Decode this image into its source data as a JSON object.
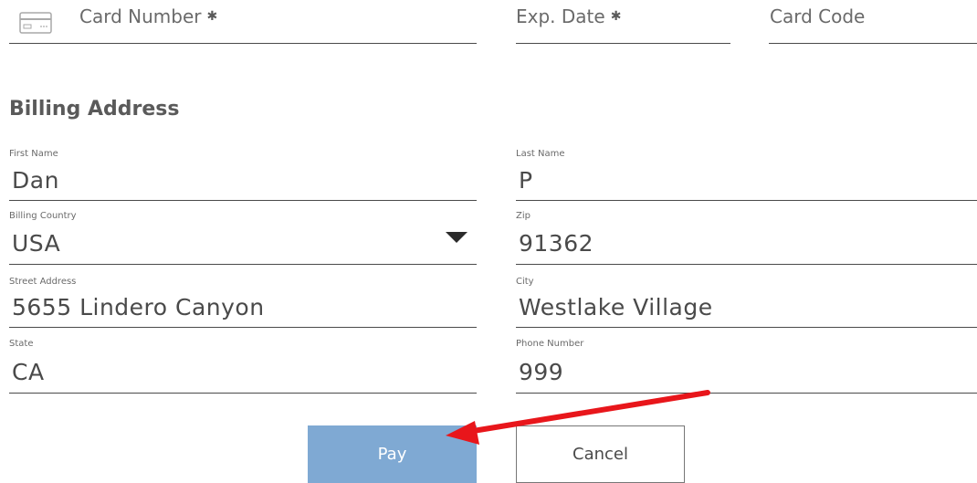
{
  "payment": {
    "card_number_label": "Card Number",
    "exp_date_label": "Exp. Date",
    "card_code_label": "Card Code",
    "required_mark": "✱"
  },
  "billing": {
    "heading": "Billing Address",
    "first_name": {
      "label": "First Name",
      "value": "Dan"
    },
    "last_name": {
      "label": "Last Name",
      "value": "P"
    },
    "country": {
      "label": "Billing Country",
      "value": "USA"
    },
    "zip": {
      "label": "Zip",
      "value": "91362"
    },
    "street": {
      "label": "Street Address",
      "value": "5655 Lindero Canyon"
    },
    "city": {
      "label": "City",
      "value": "Westlake Village"
    },
    "state": {
      "label": "State",
      "value": "CA"
    },
    "phone": {
      "label": "Phone Number",
      "value": "999"
    }
  },
  "actions": {
    "pay_label": "Pay",
    "cancel_label": "Cancel"
  },
  "colors": {
    "pay_button": "#7fa9d3",
    "annotation_arrow": "#e8161b"
  },
  "icons": {
    "card": "credit-card-icon",
    "dropdown": "caret-down-icon"
  }
}
